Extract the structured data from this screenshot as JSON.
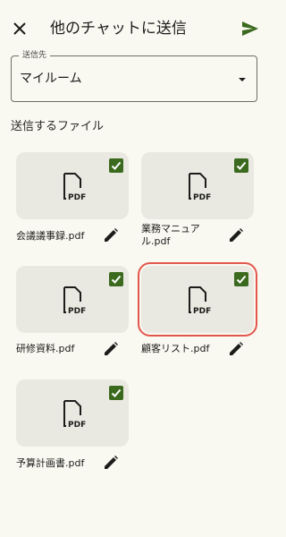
{
  "header": {
    "title": "他のチャットに送信",
    "close_icon": "close-icon",
    "send_icon": "send-icon"
  },
  "destination": {
    "label": "送信先",
    "value": "マイルーム"
  },
  "files_section": {
    "title": "送信するファイル"
  },
  "files": [
    {
      "name": "会議議事録.pdf",
      "checked": true,
      "highlighted": false
    },
    {
      "name": "業務マニュアル.pdf",
      "checked": true,
      "highlighted": false
    },
    {
      "name": "研修資料.pdf",
      "checked": true,
      "highlighted": false
    },
    {
      "name": "顧客リスト.pdf",
      "checked": true,
      "highlighted": true
    },
    {
      "name": "予算計画書.pdf",
      "checked": true,
      "highlighted": false
    }
  ],
  "colors": {
    "accent": "#3b6a1f",
    "highlight": "#e2574c",
    "background": "#f9f8f1",
    "card": "#e9e9e1"
  }
}
